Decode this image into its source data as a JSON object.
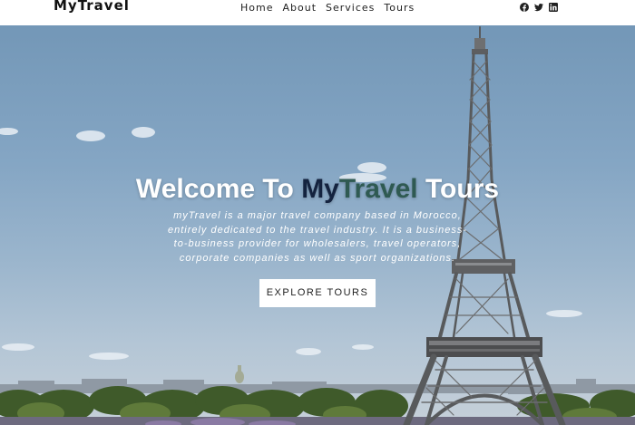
{
  "brand": "MyTravel",
  "nav": {
    "items": [
      "Home",
      "About",
      "Services",
      "Tours"
    ]
  },
  "social": {
    "icons": [
      "facebook-icon",
      "twitter-icon",
      "linkedin-icon"
    ]
  },
  "hero": {
    "title_pre": "Welcome To ",
    "title_hl1": "My",
    "title_hl2": "Travel",
    "title_post": " Tours",
    "description": "myTravel is a major travel company based in Morocco, entirely dedicated to the travel industry. It is a business-to-business provider for wholesalers, travel operators, corporate companies as well as sport organizations.",
    "cta_label": "EXPLORE TOURS"
  },
  "colors": {
    "highlight_dark": "#14233f",
    "highlight_green": "#2f5a52",
    "sky": "#7397b7",
    "navbar_bg": "#ffffff"
  }
}
